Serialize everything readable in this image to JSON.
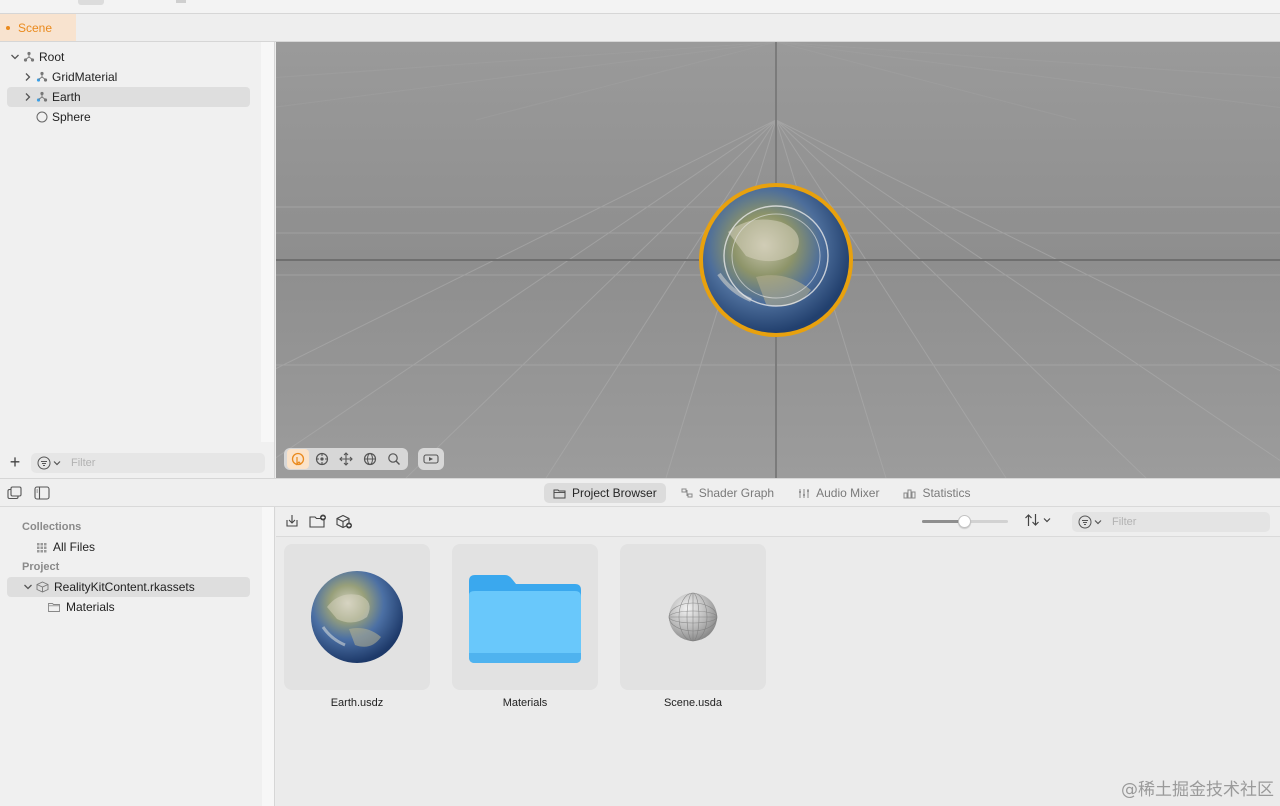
{
  "scene_tab": {
    "label": "Scene"
  },
  "hierarchy": {
    "items": [
      {
        "label": "Root",
        "expanded": true,
        "icon": "entity-icon"
      },
      {
        "label": "GridMaterial",
        "expanded": false,
        "icon": "entity-icon"
      },
      {
        "label": "Earth",
        "expanded": false,
        "icon": "entity-icon",
        "selected": true
      },
      {
        "label": "Sphere",
        "icon": "sphere-icon"
      }
    ],
    "filter_placeholder": "Filter"
  },
  "viewport": {
    "tools": [
      "select-tool-icon",
      "translate-tool-icon",
      "move-tool-icon",
      "rotate-tool-icon",
      "zoom-tool-icon"
    ],
    "active_tool": "select-tool-icon",
    "camera_button": "camera-icon"
  },
  "bottom_tabs": [
    {
      "label": "Project Browser",
      "icon": "folder-icon",
      "active": true
    },
    {
      "label": "Shader Graph",
      "icon": "shader-graph-icon",
      "active": false
    },
    {
      "label": "Audio Mixer",
      "icon": "audio-mixer-icon",
      "active": false
    },
    {
      "label": "Statistics",
      "icon": "statistics-icon",
      "active": false
    }
  ],
  "collections": {
    "collections_header": "Collections",
    "all_files": "All Files",
    "project_header": "Project",
    "project_name": "RealityKitContent.rkassets",
    "materials": "Materials"
  },
  "browser": {
    "filter_placeholder": "Filter",
    "thumbnail_size_fraction": 0.49,
    "assets": [
      {
        "name": "Earth.usdz",
        "kind": "earth-model"
      },
      {
        "name": "Materials",
        "kind": "folder"
      },
      {
        "name": "Scene.usda",
        "kind": "scene-sphere"
      }
    ]
  },
  "colors": {
    "accent": "#ea8a1d",
    "selection_ring": "#e8a10e",
    "folder": "#5ec2f7"
  },
  "watermark": "@稀土掘金技术社区"
}
